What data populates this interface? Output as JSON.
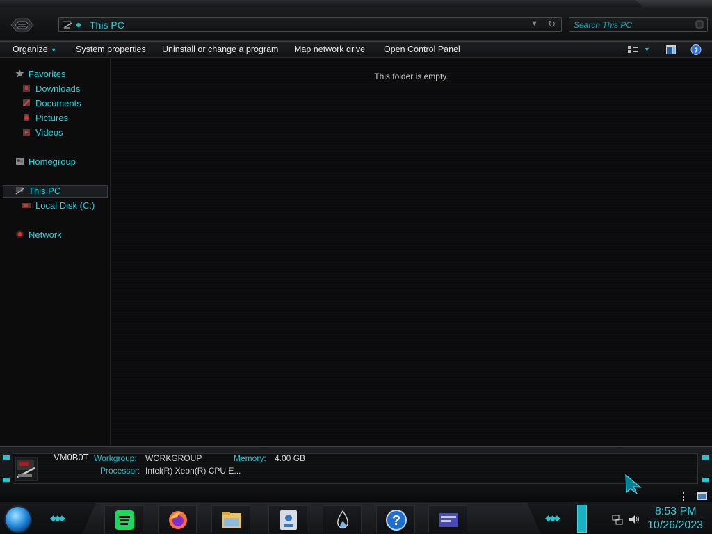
{
  "address": {
    "location": "This PC"
  },
  "search": {
    "placeholder": "Search This PC"
  },
  "toolbar": {
    "organize": "Organize",
    "system_properties": "System properties",
    "uninstall": "Uninstall or change a program",
    "map_drive": "Map network drive",
    "control_panel": "Open Control Panel"
  },
  "nav": {
    "favorites": "Favorites",
    "downloads": "Downloads",
    "documents": "Documents",
    "pictures": "Pictures",
    "videos": "Videos",
    "homegroup": "Homegroup",
    "this_pc": "This PC",
    "local_disk": "Local Disk (C:)",
    "network": "Network"
  },
  "content": {
    "empty_message": "This folder is empty."
  },
  "details": {
    "computer_name": "VM0B0T",
    "workgroup_label": "Workgroup:",
    "workgroup_value": "WORKGROUP",
    "memory_label": "Memory:",
    "memory_value": "4.00 GB",
    "processor_label": "Processor:",
    "processor_value": "Intel(R) Xeon(R) CPU E..."
  },
  "taskbar": {
    "time": "8:53 PM",
    "date": "10/26/2023",
    "apps": [
      "spotify",
      "firefox",
      "file-explorer",
      "user-account",
      "water-drop",
      "help",
      "control-panel"
    ]
  },
  "colors": {
    "accent": "#22d3dc",
    "background": "#0b0b0c"
  }
}
